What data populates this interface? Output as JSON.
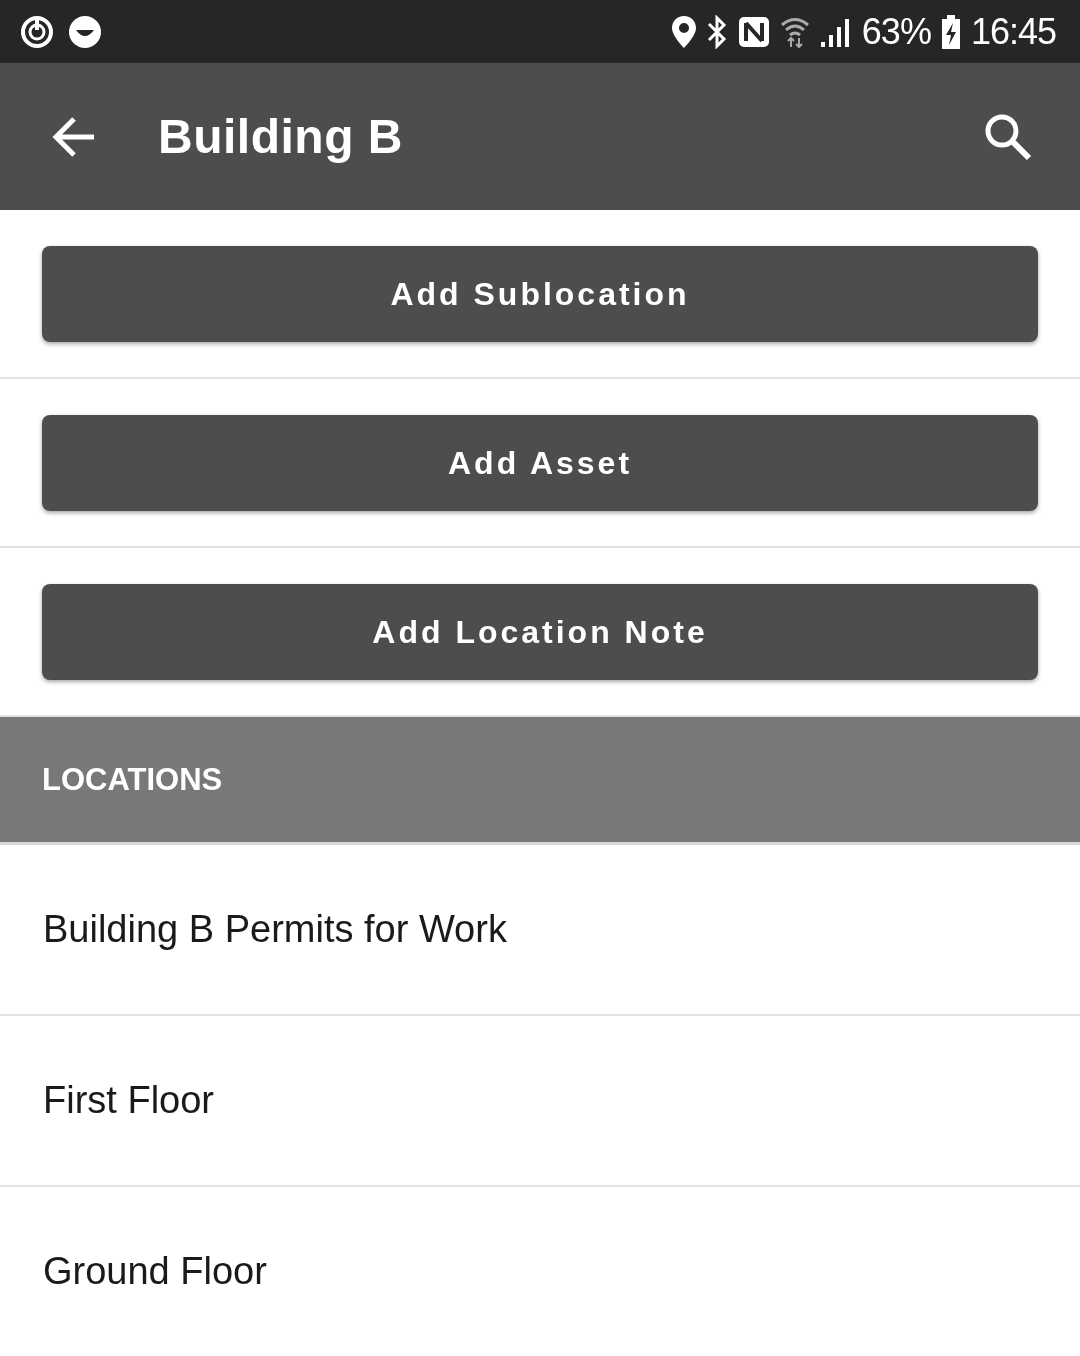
{
  "status_bar": {
    "battery": "63%",
    "time": "16:45"
  },
  "app_bar": {
    "title": "Building B"
  },
  "actions": [
    "Add Sublocation",
    "Add Asset",
    "Add Location Note"
  ],
  "section": {
    "title": "LOCATIONS"
  },
  "locations": [
    "Building B Permits for Work",
    "First Floor",
    "Ground Floor"
  ]
}
